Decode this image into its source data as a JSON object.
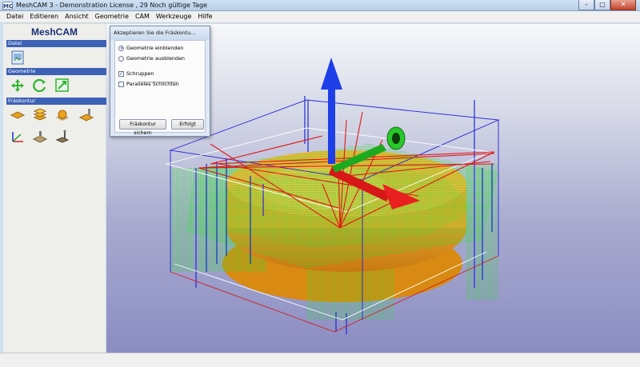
{
  "window": {
    "app_icon": "MC",
    "title": "MeshCAM 3 - Demonstration License , 29 Noch gültige Tage",
    "controls": {
      "minimize": "–",
      "maximize": "□",
      "close": "✕"
    }
  },
  "menu": [
    "Datei",
    "Editieren",
    "Ansicht",
    "Geometrie",
    "CAM",
    "Werkzeuge",
    "Hilfe"
  ],
  "sidebar": {
    "brand": "MeshCAM",
    "sections": {
      "datei": "Datei",
      "geometrie": "Geometrie",
      "fraeskontur": "Fräskontur"
    },
    "tool_icons": [
      "open-file-icon",
      "move-arrows-icon",
      "rotate-icon",
      "scale-icon",
      "layer-icon",
      "stack-layers-icon",
      "sphere-icon",
      "toolpath-height-icon",
      "axes-icon",
      "tool-setup-icon",
      "probe-icon"
    ]
  },
  "dialog": {
    "title": "Akzeptieren Sie die Fräskontu...",
    "close": "✕",
    "options": {
      "show_geometry": "Geometrie einblenden",
      "hide_geometry": "Geometrie ausblenden",
      "roughing": "Schruppen",
      "parallel_finishing": "Paralleles Schlichten"
    },
    "state": {
      "geometry_visible": true,
      "roughing_checked": true,
      "parallel_checked": false
    },
    "buttons": {
      "save": "Fräskontur sichern",
      "done": "Erfolgt"
    }
  },
  "colors": {
    "accent": "#3d62b5",
    "part": "#f0a72a",
    "roughing_paths": "#2ee02e",
    "rapid_moves": "#e01818",
    "bounding_box": "#2222d8",
    "axis_z": "#1e3ee8"
  }
}
